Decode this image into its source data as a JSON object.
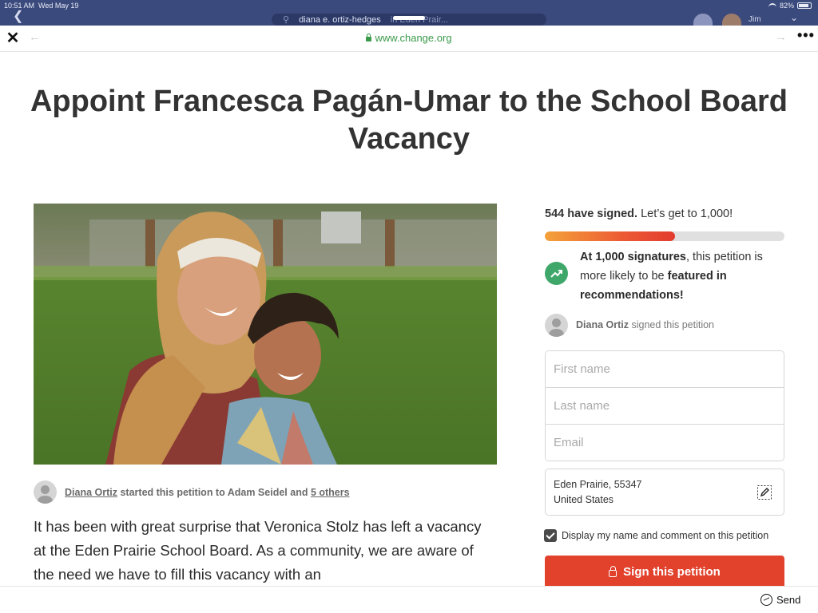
{
  "status": {
    "time": "10:51 AM",
    "date": "Wed May 19",
    "battery": "82%"
  },
  "header": {
    "search_term": "diana e. ortiz-hedges",
    "search_location": "in Eden Prair...",
    "user_name": "Jim"
  },
  "browser": {
    "url": "www.change.org"
  },
  "petition": {
    "title": "Appoint Francesca Pagán-Umar to the School Board Vacancy",
    "starter_name": "Diana Ortiz",
    "starter_mid": " started this petition to ",
    "recipient": "Adam Seidel",
    "and_word": " and ",
    "others_link": "5 others",
    "body": "It has been with great surprise that Veronica Stolz has left a vacancy at the Eden Prairie School Board. As a community, we are aware of the need we have to fill this vacancy with an"
  },
  "signatures": {
    "count_bold": "544 have signed.",
    "goal_text": " Let’s get to 1,000!",
    "progress_fraction": 0.544,
    "milestone_bold_1": "At 1,000 signatures",
    "milestone_mid": ", this petition is more likely to be ",
    "milestone_bold_2": "featured in recommendations!",
    "signer_name": "Diana Ortiz",
    "signer_action": " signed this petition"
  },
  "form": {
    "first_name_placeholder": "First name",
    "last_name_placeholder": "Last name",
    "email_placeholder": "Email",
    "location_line1": "Eden Prairie, 55347",
    "location_line2": "United States",
    "display_label": "Display my name and comment on this petition",
    "sign_label": "Sign this petition"
  },
  "footer": {
    "send_label": "Send"
  },
  "colors": {
    "brand_red": "#e2412c",
    "url_green": "#3b9a4a",
    "trend_green": "#3fa76a"
  }
}
